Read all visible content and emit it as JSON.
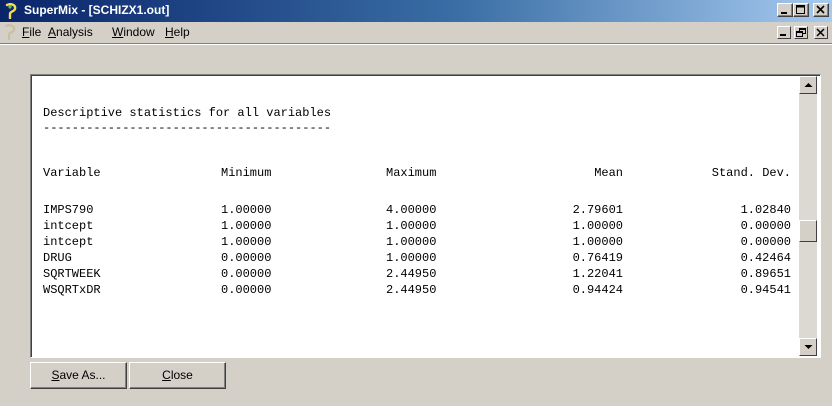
{
  "window": {
    "title": "SuperMix - [SCHIZX1.out]",
    "app_icon": "supermix-app-icon",
    "controls": [
      "minimize-icon",
      "restore-icon",
      "close-icon"
    ]
  },
  "menu": {
    "items": [
      {
        "label": "File",
        "mnemonic": "F",
        "rest": "ile"
      },
      {
        "label": "Analysis",
        "mnemonic": "A",
        "rest": "nalysis"
      },
      {
        "label": "Window",
        "mnemonic": "W",
        "rest": "indow"
      },
      {
        "label": "Help",
        "mnemonic": "H",
        "rest": "elp"
      }
    ]
  },
  "output": {
    "heading": "Descriptive statistics for all variables",
    "underline": "----------------------------------------",
    "columns": [
      "Variable",
      "Minimum",
      "Maximum",
      "Mean",
      "Stand. Dev."
    ],
    "rows": [
      [
        "IMPS790",
        "1.00000",
        "4.00000",
        "2.79601",
        "1.02840"
      ],
      [
        "intcept",
        "1.00000",
        "1.00000",
        "1.00000",
        "0.00000"
      ],
      [
        "intcept",
        "1.00000",
        "1.00000",
        "1.00000",
        "0.00000"
      ],
      [
        "DRUG",
        "0.00000",
        "1.00000",
        "0.76419",
        "0.42464"
      ],
      [
        "SQRTWEEK",
        "0.00000",
        "2.44950",
        "1.22041",
        "0.89651"
      ],
      [
        "WSQRTxDR",
        "0.00000",
        "2.44950",
        "0.94424",
        "0.94541"
      ]
    ]
  },
  "buttons": {
    "save_as": {
      "label": "Save As...",
      "mnemonic": "S",
      "rest": "ave As..."
    },
    "close": {
      "label": "Close",
      "mnemonic": "C",
      "rest": "lose"
    }
  },
  "colors": {
    "titlebar_start": "#0a246a",
    "titlebar_end": "#a6caf0",
    "face": "#d4d0c8"
  }
}
